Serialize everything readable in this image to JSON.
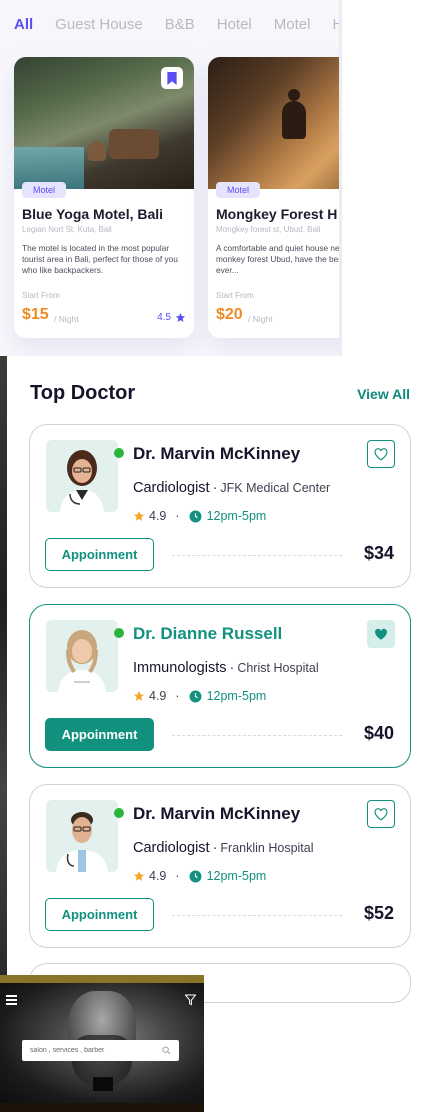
{
  "hotels": {
    "tabs": [
      "All",
      "Guest House",
      "B&B",
      "Hotel",
      "Motel",
      "H"
    ],
    "active_tab": "All",
    "cards": [
      {
        "badge": "Motel",
        "title": "Blue Yoga Motel, Bali",
        "address": "Legian Nort St, Kuta, Bali",
        "description": "The motel is located in the most popular tourist area in Bali, perfect for those of you who like backpackers.",
        "start_label": "Start From",
        "price": "$15",
        "unit": "/ Night",
        "rating": "4.5",
        "bookmarked": true
      },
      {
        "badge": "Motel",
        "title": "Mongkey Forest H",
        "address": "Mongkey forest st, Ubud, Bali",
        "description": "A comfortable and quiet house near the monkey forest Ubud, have the best holiday ever...",
        "start_label": "Start From",
        "price": "$20",
        "unit": "/ Night"
      }
    ],
    "accent": "#5a4ff0",
    "price_color": "#f08a24"
  },
  "doctors": {
    "title": "Top Doctor",
    "view_all": "View All",
    "accent": "#12917f",
    "items": [
      {
        "name": "Dr. Marvin McKinney",
        "specialty": "Cardiologist",
        "hospital": "JFK Medical Center",
        "rating": "4.9",
        "hours": "12pm-5pm",
        "button": "Appoinment",
        "price": "$34",
        "favorite": false,
        "selected": false
      },
      {
        "name": "Dr. Dianne Russell",
        "specialty": "Immunologists",
        "hospital": "Christ Hospital",
        "rating": "4.9",
        "hours": "12pm-5pm",
        "button": "Appoinment",
        "price": "$40",
        "favorite": true,
        "selected": true
      },
      {
        "name": "Dr. Marvin McKinney",
        "specialty": "Cardiologist",
        "hospital": "Franklin Hospital",
        "rating": "4.9",
        "hours": "12pm-5pm",
        "button": "Appoinment",
        "price": "$52",
        "favorite": false,
        "selected": false
      }
    ]
  },
  "barber": {
    "search_placeholder": "salon , services , barber"
  }
}
